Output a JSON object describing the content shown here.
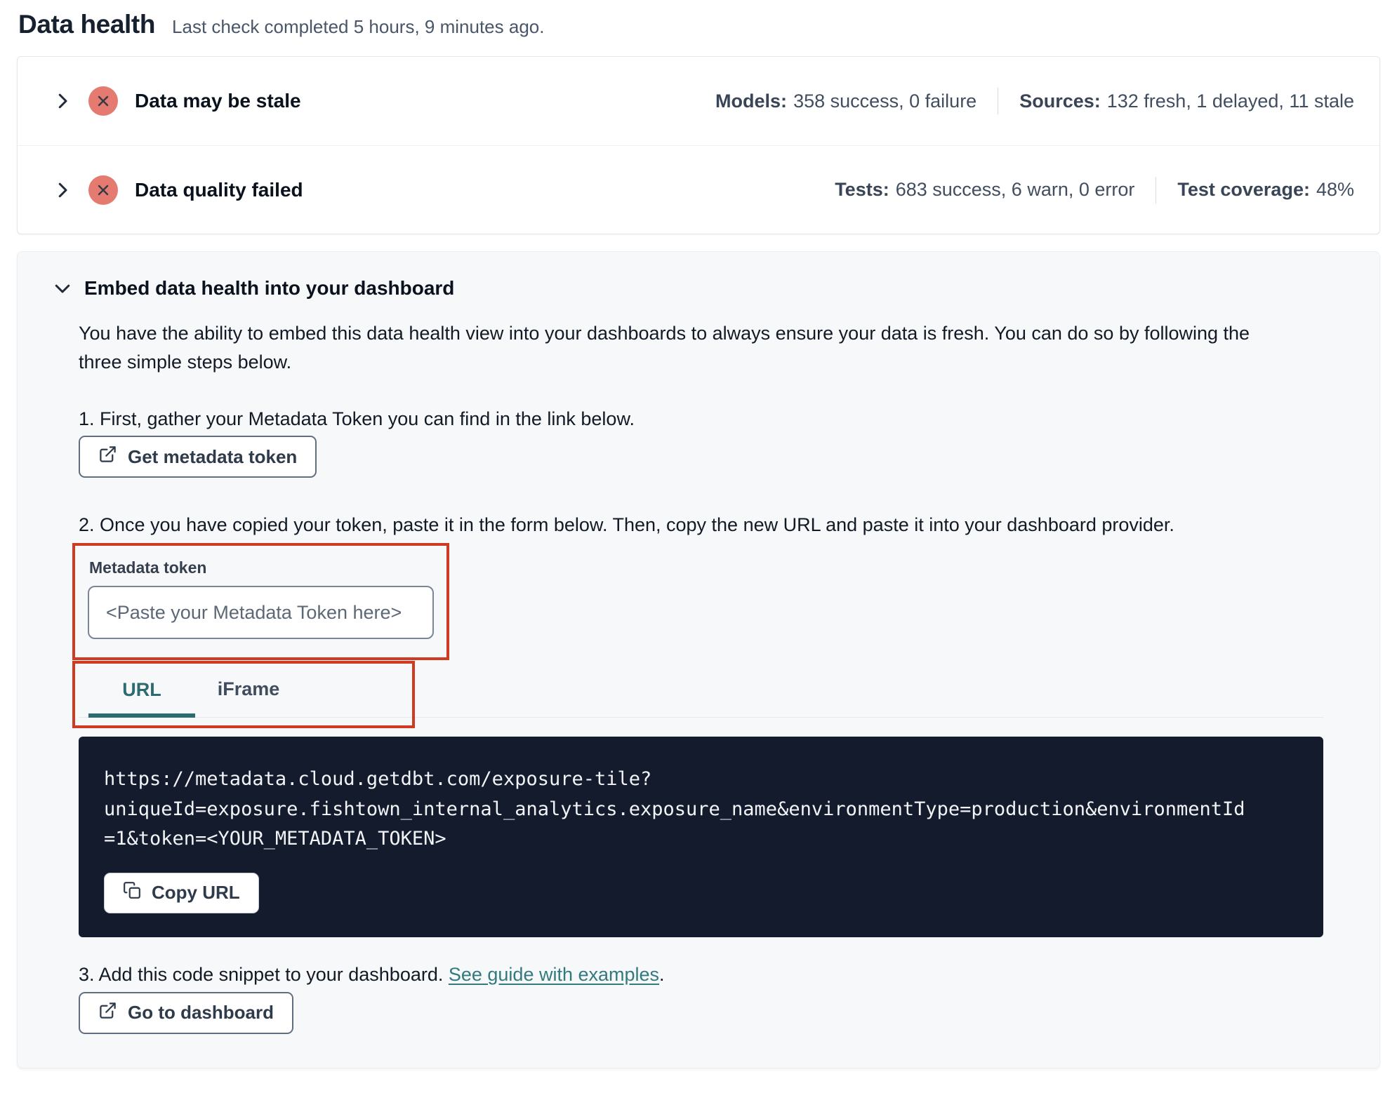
{
  "header": {
    "title": "Data health",
    "subtitle": "Last check completed 5 hours, 9 minutes ago."
  },
  "status_rows": [
    {
      "title": "Data may be stale",
      "status": "error",
      "stats": [
        {
          "label": "Models:",
          "value": "358 success, 0 failure"
        },
        {
          "label": "Sources:",
          "value": "132 fresh, 1 delayed, 11 stale"
        }
      ]
    },
    {
      "title": "Data quality failed",
      "status": "error",
      "stats": [
        {
          "label": "Tests:",
          "value": "683 success, 6 warn, 0 error"
        },
        {
          "label": "Test coverage:",
          "value": "48%"
        }
      ]
    }
  ],
  "embed": {
    "title": "Embed data health into your dashboard",
    "description": "You have the ability to embed this data health view into your dashboards to always ensure your data is fresh. You can do so by following the three simple steps below.",
    "step1": "1. First, gather your Metadata Token you can find in the link below.",
    "get_token_button": "Get metadata token",
    "step2": "2. Once you have copied your token, paste it in the form below. Then, copy the new URL and paste it into your dashboard provider.",
    "token_field": {
      "label": "Metadata token",
      "placeholder": "<Paste your Metadata Token here>"
    },
    "tabs": [
      {
        "label": "URL",
        "active": true
      },
      {
        "label": "iFrame",
        "active": false
      }
    ],
    "url": "https://metadata.cloud.getdbt.com/exposure-tile?uniqueId=exposure.fishtown_internal_analytics.exposure_name&environmentType=production&environmentId=1&token=<YOUR_METADATA_TOKEN>",
    "url_lines": [
      "https://metadata.cloud.getdbt.com/exposure-tile?",
      "uniqueId=exposure.fishtown_internal_analytics.exposure_name&environmentType=production&environmentId",
      "=1&token=<YOUR_METADATA_TOKEN>"
    ],
    "copy_button": "Copy URL",
    "step3_prefix": "3. Add this code snippet to your dashboard. ",
    "step3_link": "See guide with examples",
    "step3_suffix": ".",
    "dashboard_button": "Go to dashboard"
  },
  "colors": {
    "annotation_red": "#CF3B22",
    "teal": "#2C6B70",
    "badge_red": "#E57A70",
    "code_bg": "#131B2C"
  }
}
